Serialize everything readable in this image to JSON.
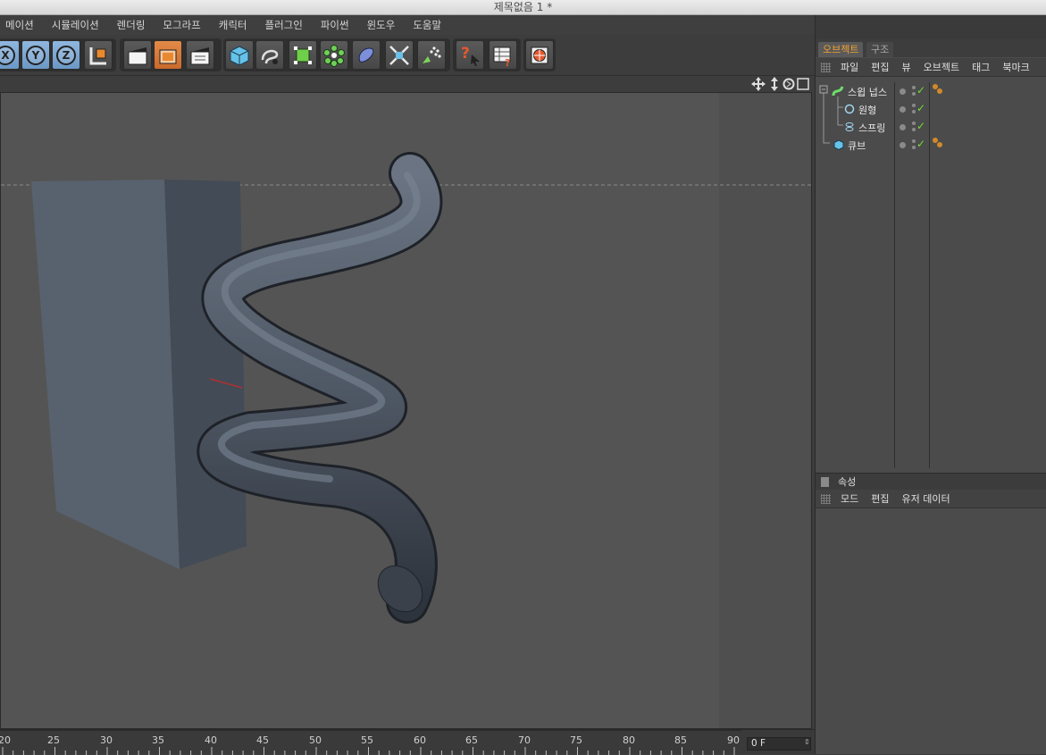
{
  "window": {
    "title": "제목없음 1 *"
  },
  "menubar": {
    "items": [
      "메이션",
      "시뮬레이션",
      "렌더링",
      "모그라프",
      "캐릭터",
      "플러그인",
      "파이썬",
      "윈도우",
      "도움말"
    ]
  },
  "toolbar": {
    "axis_x": "X",
    "axis_y": "Y",
    "axis_z": "Z"
  },
  "object_manager": {
    "tabs": [
      {
        "label": "오브젝트",
        "active": true
      },
      {
        "label": "구조",
        "active": false
      }
    ],
    "menu": [
      "파일",
      "편집",
      "뷰",
      "오브젝트",
      "태그",
      "북마크"
    ],
    "objects": [
      {
        "name": "스윕 넙스",
        "icon": "sweep-nurbs-icon",
        "depth": 0,
        "tags": true
      },
      {
        "name": "원형",
        "icon": "circle-spline-icon",
        "depth": 1,
        "tags": false
      },
      {
        "name": "스프링",
        "icon": "helix-spline-icon",
        "depth": 1,
        "tags": false
      },
      {
        "name": "큐브",
        "icon": "cube-icon",
        "depth": 0,
        "tags": true
      }
    ]
  },
  "attributes": {
    "title": "속성",
    "menu": [
      "모드",
      "편집",
      "유저 데이터"
    ]
  },
  "timeline": {
    "ticks": [
      "20",
      "25",
      "30",
      "35",
      "40",
      "45",
      "50",
      "55",
      "60",
      "65",
      "70",
      "75",
      "80",
      "85",
      "90"
    ],
    "current_frame": "0 F"
  },
  "colors": {
    "accent": "#f0a030",
    "check": "#6fdc3b",
    "viewport": "#545454"
  }
}
